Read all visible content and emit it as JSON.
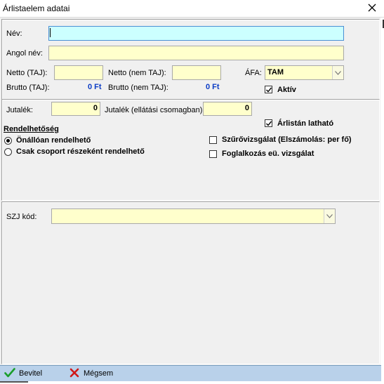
{
  "window": {
    "title": "Árlistaelem adatai",
    "close_label": "X"
  },
  "fields": {
    "nev_label": "Név:",
    "angol_nev_label": "Angol név:",
    "netto_taj_label": "Netto (TAJ):",
    "netto_nem_taj_label": "Netto (nem TAJ):",
    "afa_label": "ÁFA:",
    "afa_value": "TAM",
    "brutto_taj_label": "Brutto (TAJ):",
    "brutto_taj_value": "0 Ft",
    "brutto_nem_taj_label": "Brutto (nem TAJ):",
    "brutto_nem_taj_value": "0 Ft",
    "aktiv_label": "Aktív",
    "aktiv_checked": true
  },
  "section2": {
    "jutalek_label": "Jutalék:",
    "jutalek_value": "0",
    "jutalek_csomag_label": "Jutalék (ellátási csomagban):",
    "jutalek_csomag_value": "0",
    "arlistan_label": "Árlistán latható",
    "arlistan_checked": true,
    "rendelhetoseg_heading": "Rendelhetőség",
    "radio_onallo": "Önállóan rendelhető",
    "radio_csoport": "Csak csoport részeként rendelhető",
    "radio_selected": "onallo",
    "szurovizsgalat_label": "Szűrővizsgálat (Elszámolás: per fő)",
    "foglalkozas_label": "Foglalkozás eü. vizsgálat"
  },
  "section3": {
    "szj_label": "SZJ kód:"
  },
  "footer": {
    "ok_label": "Bevitel",
    "cancel_label": "Mégsem"
  },
  "colors": {
    "input_yellow": "#ffffcc",
    "input_cyan": "#ccffff",
    "value_blue": "#0b3cc5",
    "footer_bar": "#b9d1ea"
  }
}
